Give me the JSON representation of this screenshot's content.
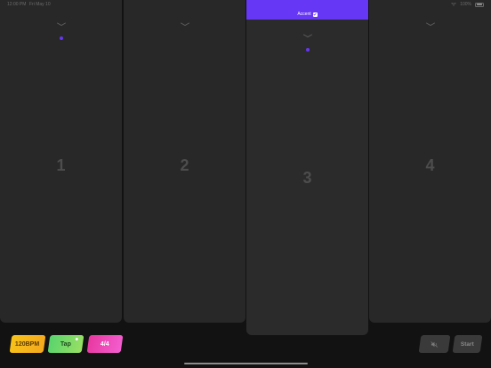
{
  "status_bar": {
    "time": "12:00 PM",
    "date": "Fri May 10",
    "battery": "100%",
    "wifi_icon": "wifi-icon",
    "battery_icon": "battery-icon"
  },
  "beats": [
    {
      "number": "1",
      "active": false,
      "accent": false,
      "indicator": true
    },
    {
      "number": "2",
      "active": false,
      "accent": false,
      "indicator": false
    },
    {
      "number": "3",
      "active": true,
      "accent": true,
      "indicator": true
    },
    {
      "number": "4",
      "active": false,
      "accent": false,
      "indicator": false
    }
  ],
  "accent": {
    "label": "Accent",
    "checked": true,
    "color": "#6637f4"
  },
  "controls": {
    "bpm_label": "120BPM",
    "tap_label": "Tap",
    "time_signature_label": "4/4",
    "mute_icon": "speaker-mute-icon",
    "start_label": "Start"
  },
  "colors": {
    "background": "#121212",
    "column": "#282828",
    "bpm": "#f7c319",
    "tap": "#57d46d",
    "time_signature": "#e8379f",
    "indicator": "#6637f4"
  }
}
